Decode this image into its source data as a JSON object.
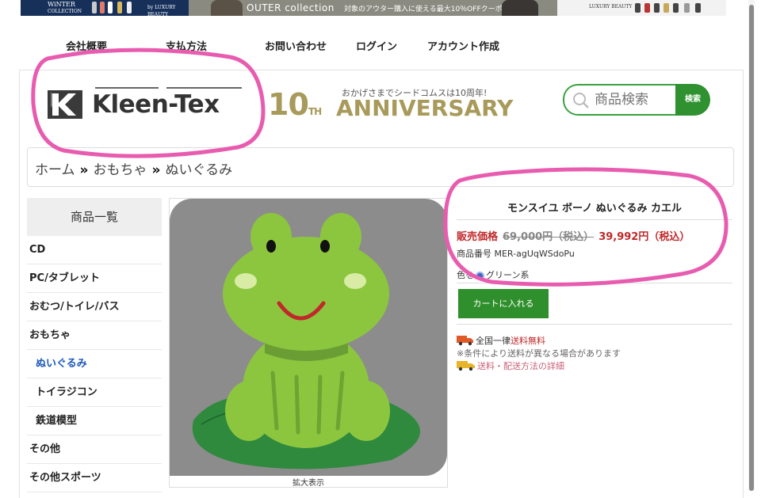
{
  "banner": {
    "left_title_line1": "WiNTER",
    "left_title_line2": "COLLECTION",
    "left_small": "by LUXURY BEAUTY",
    "center_title": "OUTER collection",
    "center_promo": "対象のアウター購入に使える最大10％OFFクーポン",
    "right_small": "LUXURY BEAUTY"
  },
  "topnav": {
    "company": "会社概要",
    "payment": "支払方法",
    "contact": "お問い合わせ",
    "login": "ログイン",
    "account": "アカウント作成"
  },
  "header": {
    "logo_text": "Kleen-Tex",
    "anniv_sub": "おかげさまでシードコムスは10周年!",
    "anniv_num": "10",
    "anniv_th": "TH",
    "anniv_word": "ANNIVERSARY"
  },
  "search": {
    "placeholder": "商品検索",
    "button_label": "検索"
  },
  "breadcrumb": {
    "items": [
      "ホーム",
      "おもちゃ",
      "ぬいぐるみ"
    ],
    "separator": "»"
  },
  "sidebar": {
    "heading": "商品一覧",
    "items": [
      {
        "label": "CD"
      },
      {
        "label": "PC/タブレット"
      },
      {
        "label": "おむつ/トイレ/バス"
      },
      {
        "label": "おもちゃ"
      },
      {
        "label": "ぬいぐるみ"
      },
      {
        "label": "トイラジコン"
      },
      {
        "label": "鉄道模型"
      },
      {
        "label": "その他"
      },
      {
        "label": "その他スポーツ"
      }
    ]
  },
  "product": {
    "title": "モンスイユ ボーノ ぬいぐるみ カエル",
    "price_label": "販売価格",
    "old_price": "69,000円（税込）",
    "new_price": "39,992円（税込）",
    "sku": "商品番号 MER-agUqWSdoPu",
    "color_prefix": "色を",
    "color_value": "グリーン系",
    "cart_button": "カートに入れる",
    "ship_text": "全国一律",
    "ship_free": "送料無料",
    "ship_note": "※条件により送料が異なる場合があります",
    "ship_link": "送料・配送方法の詳細",
    "zoom_label": "拡大表示"
  },
  "colors": {
    "accent_green": "#2f8f2c",
    "price_red": "#c0292b",
    "annotation_pink": "#e85cb0"
  }
}
